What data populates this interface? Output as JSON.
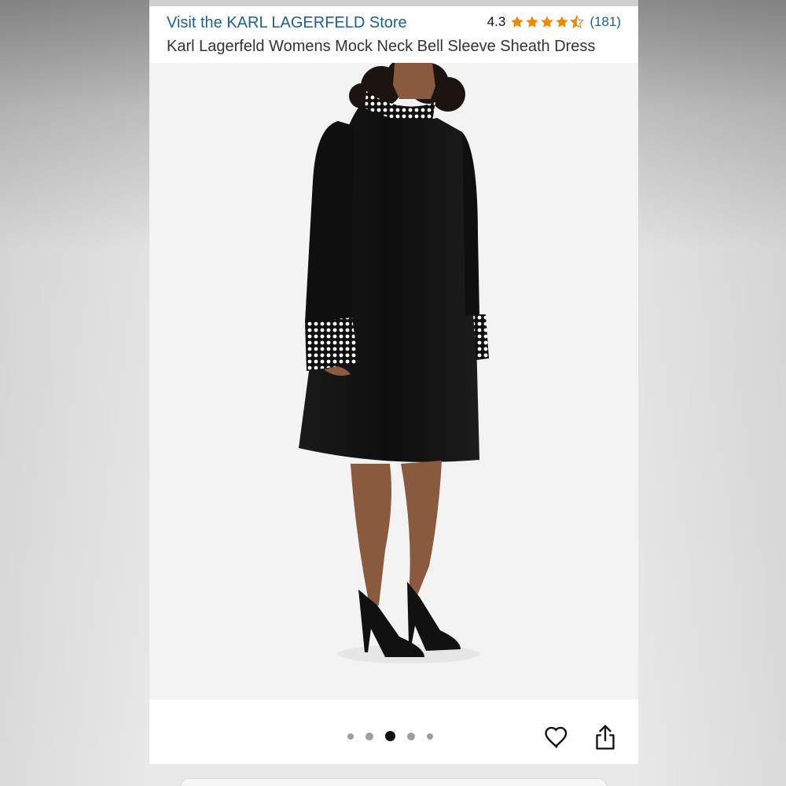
{
  "header": {
    "store_link": "Visit the KARL LAGERFELD Store",
    "rating_value": "4.3",
    "rating_stars": 4.3,
    "review_count": "(181)",
    "product_title": "Karl Lagerfeld Womens Mock Neck Bell Sleeve Sheath Dress"
  },
  "gallery": {
    "image_count": 5,
    "active_index": 2
  },
  "actions": {
    "wishlist_icon": "heart-icon",
    "share_icon": "share-icon"
  },
  "colors": {
    "link": "#1d5f99",
    "star": "#f08804",
    "dress": "#111111"
  }
}
